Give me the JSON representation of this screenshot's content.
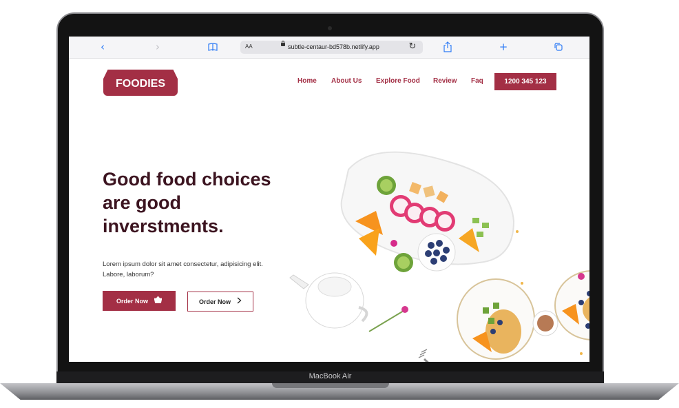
{
  "browser": {
    "address_text_size": "AA",
    "url": "subtle-centaur-bd578b.netlify.app",
    "icons": [
      "back-icon",
      "forward-icon",
      "bookmarks-icon",
      "reload-icon",
      "share-icon",
      "new-tab-icon",
      "tabs-icon"
    ],
    "icon_glyphs": {
      "back": "‹",
      "forward": "›",
      "bookmarks": "📖",
      "reload": "↻",
      "share": "⇧",
      "new_tab": "+",
      "tabs": "⧉"
    }
  },
  "device": {
    "label": "MacBook Air"
  },
  "site": {
    "logo": "FOODIES",
    "nav": [
      "Home",
      "About Us",
      "Explore Food",
      "Review",
      "Faq"
    ],
    "phone": "1200 345 123",
    "hero": {
      "headline": "Good food choices are good inverstments.",
      "body": "Lorem ipsum dolor sit amet consectetur, adipisicing elit. Labore, laborum?",
      "primary_button": "Order Now",
      "secondary_button": "Order Now",
      "primary_icon": "basket-icon",
      "secondary_icon": "chevron-right-icon"
    },
    "colors": {
      "brand": "#a32f45",
      "headline": "#3c1420",
      "link": "#2f7cf6"
    }
  }
}
